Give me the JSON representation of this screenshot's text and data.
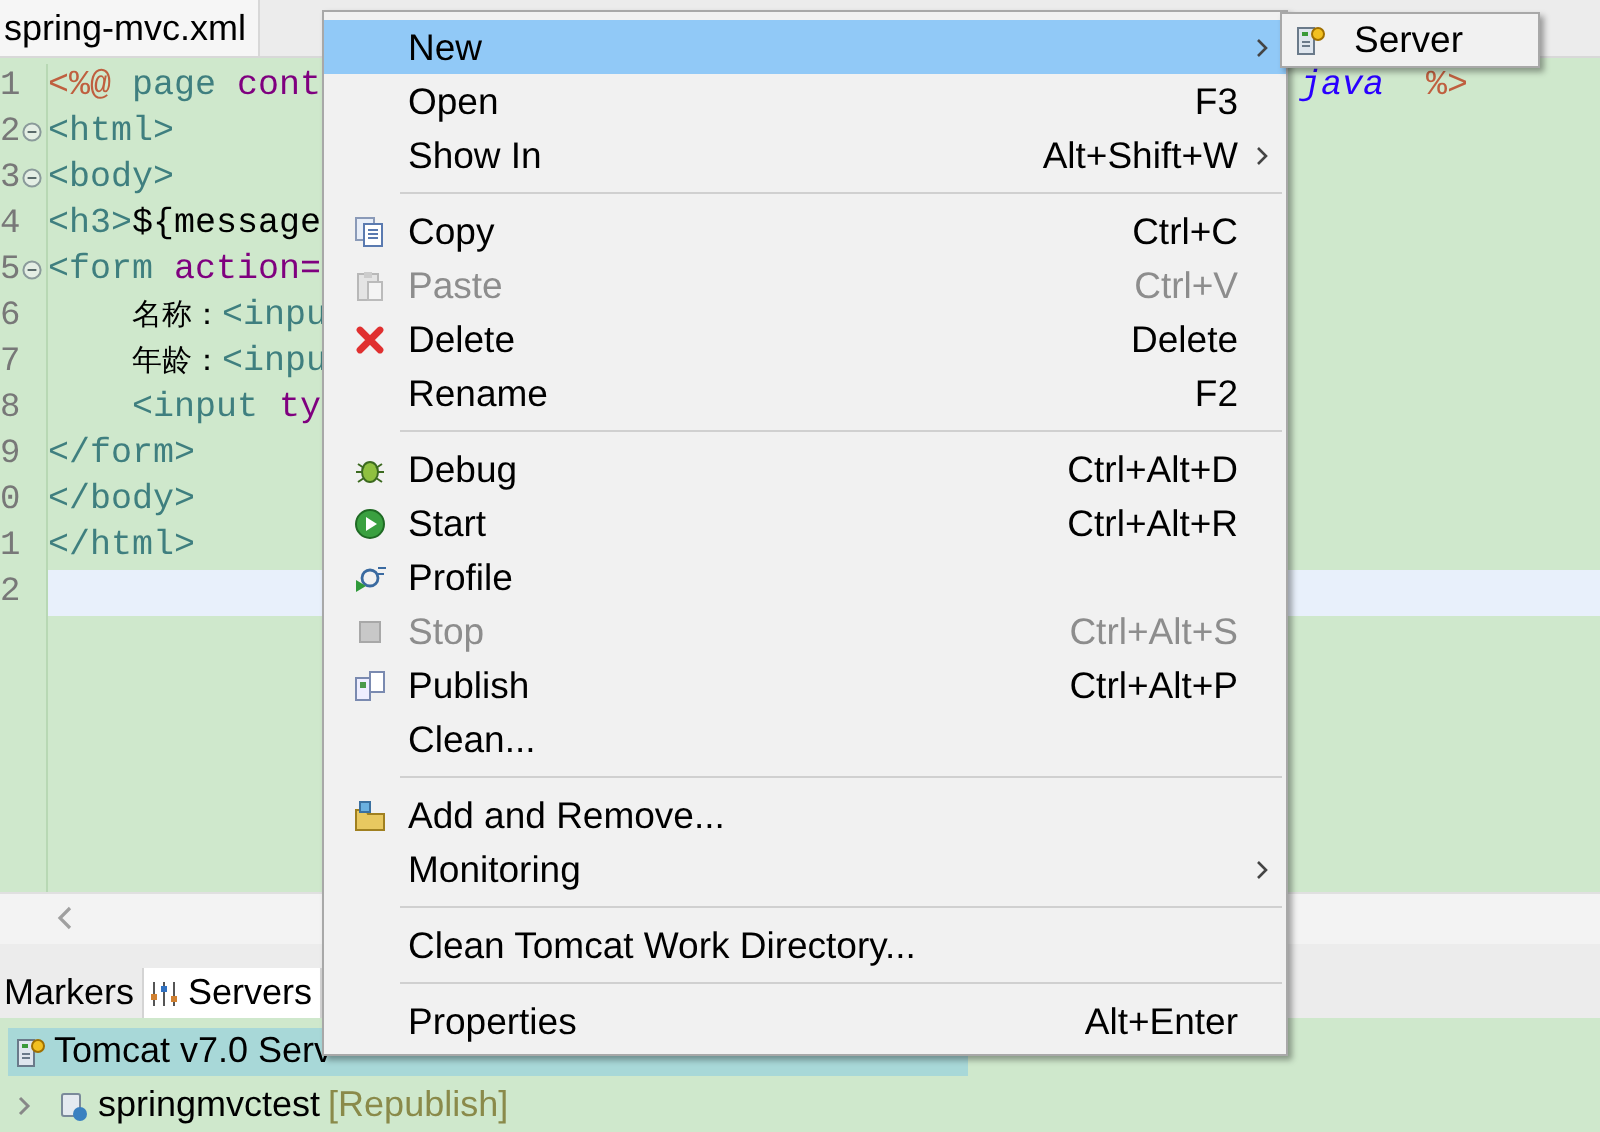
{
  "editor": {
    "tab_title": "spring-mvc.xml",
    "lines": [
      {
        "number": "1",
        "tokens": [
          {
            "text": "<%@",
            "kind": "directive"
          },
          {
            "text": " page ",
            "kind": "tag"
          },
          {
            "text": "cont",
            "kind": "attr"
          }
        ],
        "right_tokens": [
          {
            "text": "java",
            "kind": "value"
          },
          {
            "text": "%>",
            "kind": "directive"
          }
        ]
      },
      {
        "number": "2",
        "collapsible": true,
        "tokens": [
          {
            "text": "<html>",
            "kind": "tag"
          }
        ]
      },
      {
        "number": "3",
        "collapsible": true,
        "tokens": [
          {
            "text": "<body>",
            "kind": "tag"
          }
        ]
      },
      {
        "number": "4",
        "tokens": [
          {
            "text": "<h3>",
            "kind": "tag"
          },
          {
            "text": "${message",
            "kind": "text"
          }
        ]
      },
      {
        "number": "5",
        "collapsible": true,
        "tokens": [
          {
            "text": "<form ",
            "kind": "tag"
          },
          {
            "text": "action=",
            "kind": "attr"
          }
        ]
      },
      {
        "number": "6",
        "indented": true,
        "tokens": [
          {
            "text": "名称：",
            "kind": "cjk"
          },
          {
            "text": "<inpu",
            "kind": "tag"
          }
        ]
      },
      {
        "number": "7",
        "indented": true,
        "tokens": [
          {
            "text": "年龄：",
            "kind": "cjk"
          },
          {
            "text": "<inpu",
            "kind": "tag"
          }
        ]
      },
      {
        "number": "8",
        "indented": true,
        "tokens": [
          {
            "text": "<input ",
            "kind": "tag"
          },
          {
            "text": "ty",
            "kind": "attr"
          }
        ]
      },
      {
        "number": "9",
        "tokens": [
          {
            "text": "</form>",
            "kind": "tag"
          }
        ]
      },
      {
        "number": "0",
        "tokens": [
          {
            "text": "</body>",
            "kind": "tag"
          }
        ]
      },
      {
        "number": "1",
        "tokens": [
          {
            "text": "</html>",
            "kind": "tag"
          }
        ]
      },
      {
        "number": "2",
        "current": true
      }
    ]
  },
  "bottom_panel": {
    "tabs": [
      {
        "label": "Markers",
        "selected": false
      },
      {
        "label": "Servers",
        "selected": true
      }
    ],
    "tree": [
      {
        "label": "Tomcat v7.0 Serv",
        "selected": true,
        "children": [
          {
            "label": "springmvctest",
            "status": "[Republish]",
            "selected": false,
            "expanded": false
          }
        ]
      }
    ]
  },
  "context_menu": {
    "items": [
      {
        "kind": "item",
        "label": "New",
        "submenu": true,
        "selected": true,
        "disabled": false
      },
      {
        "kind": "item",
        "label": "Open",
        "shortcut": "F3",
        "selected": false,
        "disabled": false
      },
      {
        "kind": "item",
        "label": "Show In",
        "shortcut": "Alt+Shift+W",
        "submenu": true,
        "selected": false,
        "disabled": false
      },
      {
        "kind": "separator"
      },
      {
        "kind": "item",
        "label": "Copy",
        "shortcut": "Ctrl+C",
        "selected": false,
        "disabled": false
      },
      {
        "kind": "item",
        "label": "Paste",
        "shortcut": "Ctrl+V",
        "selected": false,
        "disabled": true
      },
      {
        "kind": "item",
        "label": "Delete",
        "shortcut": "Delete",
        "selected": false,
        "disabled": false
      },
      {
        "kind": "item",
        "label": "Rename",
        "shortcut": "F2",
        "selected": false,
        "disabled": false
      },
      {
        "kind": "separator"
      },
      {
        "kind": "item",
        "label": "Debug",
        "shortcut": "Ctrl+Alt+D",
        "selected": false,
        "disabled": false
      },
      {
        "kind": "item",
        "label": "Start",
        "shortcut": "Ctrl+Alt+R",
        "selected": false,
        "disabled": false
      },
      {
        "kind": "item",
        "label": "Profile",
        "selected": false,
        "disabled": false
      },
      {
        "kind": "item",
        "label": "Stop",
        "shortcut": "Ctrl+Alt+S",
        "selected": false,
        "disabled": true
      },
      {
        "kind": "item",
        "label": "Publish",
        "shortcut": "Ctrl+Alt+P",
        "selected": false,
        "disabled": false
      },
      {
        "kind": "item",
        "label": "Clean...",
        "selected": false,
        "disabled": false
      },
      {
        "kind": "separator"
      },
      {
        "kind": "item",
        "label": "Add and Remove...",
        "selected": false,
        "disabled": false
      },
      {
        "kind": "item",
        "label": "Monitoring",
        "submenu": true,
        "selected": false,
        "disabled": false
      },
      {
        "kind": "separator"
      },
      {
        "kind": "item",
        "label": "Clean Tomcat Work Directory...",
        "selected": false,
        "disabled": false
      },
      {
        "kind": "separator"
      },
      {
        "kind": "item",
        "label": "Properties",
        "shortcut": "Alt+Enter",
        "selected": false,
        "disabled": false
      }
    ]
  },
  "submenu": {
    "items": [
      {
        "label": "Server"
      }
    ]
  }
}
